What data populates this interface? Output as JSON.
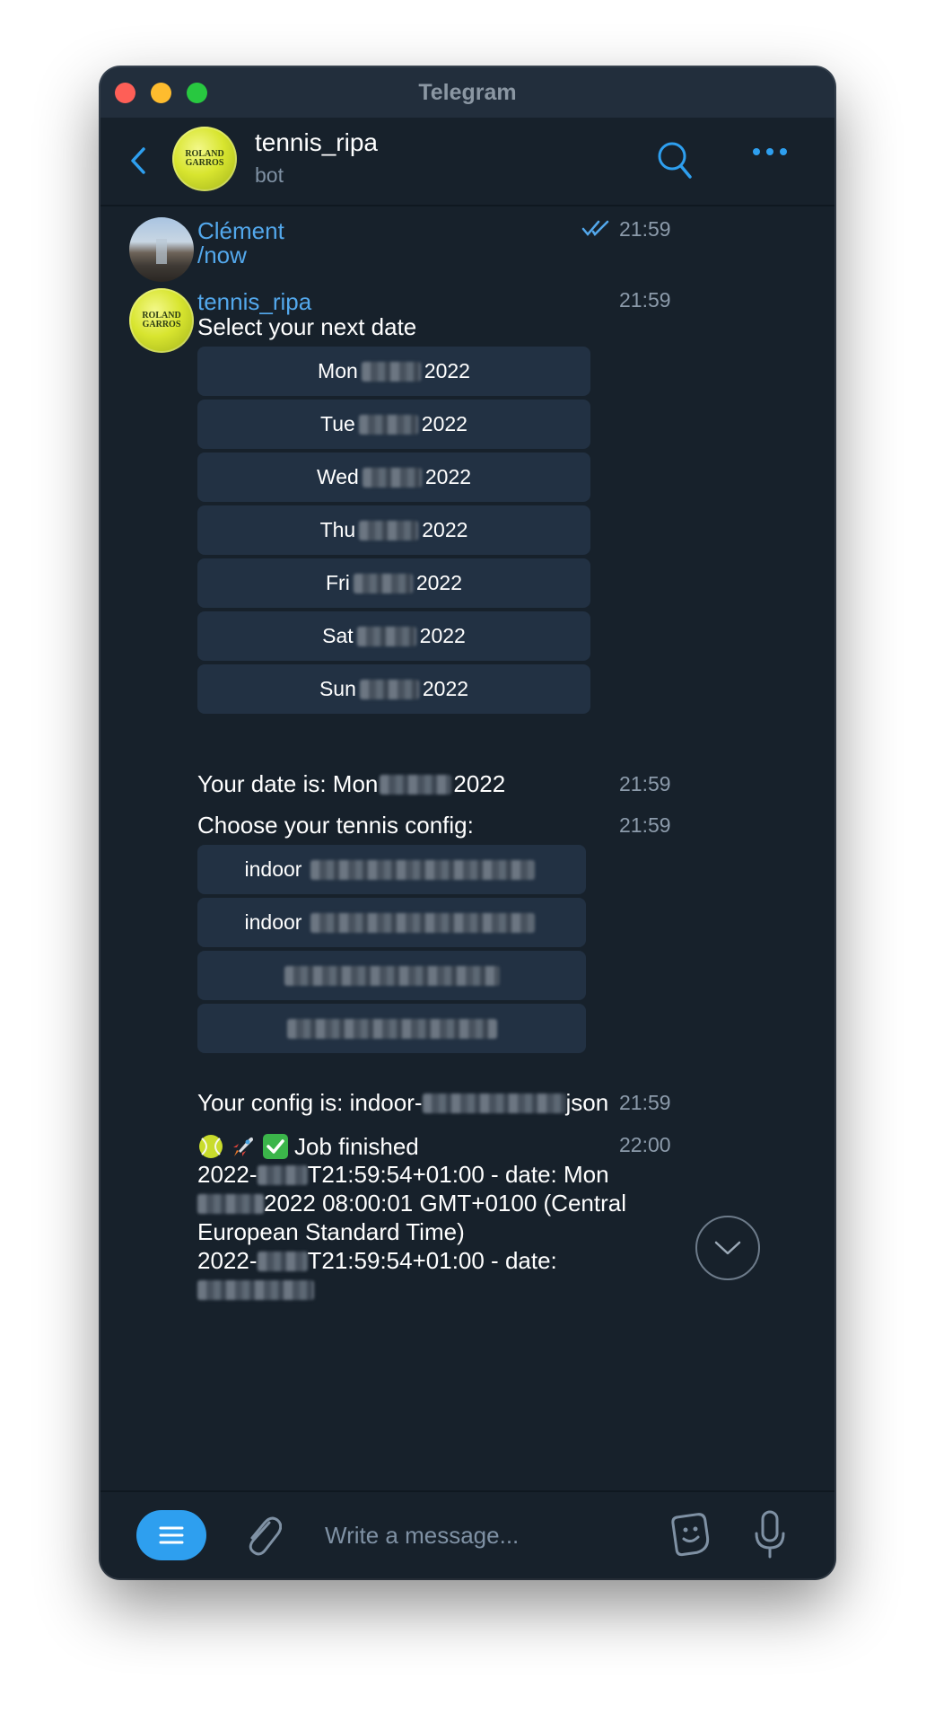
{
  "window": {
    "title": "Telegram"
  },
  "header": {
    "name": "tennis_ripa",
    "subtitle": "bot",
    "avatar_text": [
      "ROLAND",
      "GARROS"
    ],
    "icons": [
      "back-chevron-icon",
      "search-icon",
      "more-dots-icon"
    ]
  },
  "messages": {
    "m1": {
      "sender": "Clément",
      "text": "/now",
      "time": "21:59",
      "status": "read"
    },
    "m2": {
      "sender": "tennis_ripa",
      "text": "Select your next date",
      "time": "21:59",
      "buttons": [
        {
          "day": "Mon",
          "year": "2022"
        },
        {
          "day": "Tue",
          "year": "2022"
        },
        {
          "day": "Wed",
          "year": "2022"
        },
        {
          "day": "Thu",
          "year": "2022"
        },
        {
          "day": "Fri",
          "year": "2022"
        },
        {
          "day": "Sat",
          "year": "2022"
        },
        {
          "day": "Sun",
          "year": "2022"
        }
      ]
    },
    "m3": {
      "prefix": "Your date is: Mon",
      "suffix": "2022",
      "time": "21:59"
    },
    "m4": {
      "text": "Choose your tennis config:",
      "time": "21:59",
      "buttons": [
        "indoor",
        "indoor",
        "",
        ""
      ]
    },
    "m5": {
      "prefix": "Your config is: indoor-",
      "suffix": "json",
      "time": "21:59"
    },
    "m6": {
      "title": "Job finished",
      "time": "22:00",
      "line1_prefix": "2022-",
      "line1_suffix": "T21:59:54+01:00 - date: Mon",
      "line2_suffix": "2022 08:00:01 GMT+0100 (Central",
      "line3": "European Standard Time)",
      "line4_prefix": "2022-",
      "line4_suffix": "T21:59:54+01:00 - date:"
    }
  },
  "composer": {
    "placeholder": "Write a message...",
    "icons": [
      "menu-icon",
      "paperclip-icon",
      "sticker-icon",
      "microphone-icon"
    ]
  },
  "colors": {
    "background": "#17212b",
    "accent": "#53a8ec",
    "button": "#223143",
    "menu_button": "#2e9fef"
  }
}
